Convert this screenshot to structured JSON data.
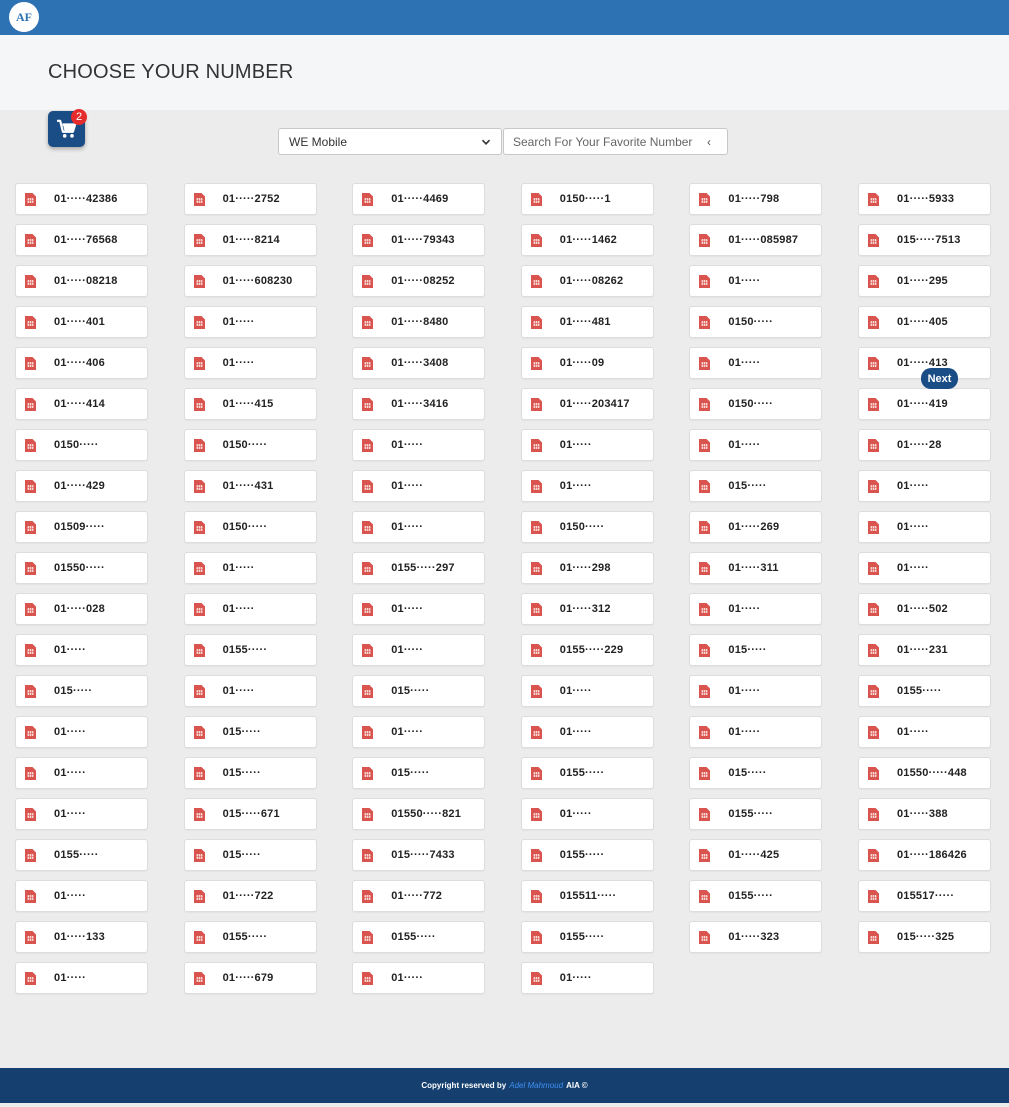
{
  "header": {
    "logo_text": "AF",
    "title": "CHOOSE YOUR NUMBER"
  },
  "cart": {
    "icon": "shopping-cart-icon",
    "count": "2"
  },
  "filters": {
    "operator_selected": "WE Mobile",
    "search_placeholder": "Search For Your Favorite Number",
    "search_icon": "chevron-left-icon"
  },
  "next_label": "Next",
  "numbers": [
    "01·····42386",
    "01·····2752",
    "01·····4469",
    "0150·····1",
    "01·····798",
    "01·····5933",
    "01·····76568",
    "01·····8214",
    "01·····79343",
    "01·····1462",
    "01·····085987",
    "015·····7513",
    "01·····08218",
    "01·····608230",
    "01·····08252",
    "01·····08262",
    "01·····",
    "01·····295",
    "01·····401",
    "01·····",
    "01·····8480",
    "01·····481",
    "0150·····",
    "01·····405",
    "01·····406",
    "01·····",
    "01·····3408",
    "01·····09",
    "01·····",
    "01·····413",
    "01·····414",
    "01·····415",
    "01·····3416",
    "01·····203417",
    "0150·····",
    "01·····419",
    "0150·····",
    "0150·····",
    "01·····",
    "01·····",
    "01·····",
    "01·····28",
    "01·····429",
    "01·····431",
    "01·····",
    "01·····",
    "015·····",
    "01·····",
    "01509·····",
    "0150·····",
    "01·····",
    "0150·····",
    "01·····269",
    "01·····",
    "01550·····",
    "01·····",
    "0155·····297",
    "01·····298",
    "01·····311",
    "01·····",
    "01·····028",
    "01·····",
    "01·····",
    "01·····312",
    "01·····",
    "01·····502",
    "01·····",
    "0155·····",
    "01·····",
    "0155·····229",
    "015·····",
    "01·····231",
    "015·····",
    "01·····",
    "015·····",
    "01·····",
    "01·····",
    "0155·····",
    "01·····",
    "015·····",
    "01·····",
    "01·····",
    "01·····",
    "01·····",
    "01·····",
    "015·····",
    "015·····",
    "0155·····",
    "015·····",
    "01550·····448",
    "01·····",
    "015·····671",
    "01550·····821",
    "01·····",
    "0155·····",
    "01·····388",
    "0155·····",
    "015·····",
    "015·····7433",
    "0155·····",
    "01·····425",
    "01·····186426",
    "01·····",
    "01·····722",
    "01·····772",
    "015511·····",
    "0155·····",
    "015517·····",
    "01·····133",
    "0155·····",
    "0155·····",
    "0155·····",
    "01·····323",
    "015·····325",
    "01·····",
    "01·····679",
    "01·····",
    "01·····"
  ],
  "footer": {
    "prefix": "Copyright reserved by",
    "author": "Adel Mahmoud",
    "suffix": "AIA ©"
  },
  "colors": {
    "topbar": "#2d72b3",
    "accent": "#1a4c86",
    "footer": "#143f6f",
    "badge": "#e52b2b",
    "sim": "#d9534f"
  }
}
